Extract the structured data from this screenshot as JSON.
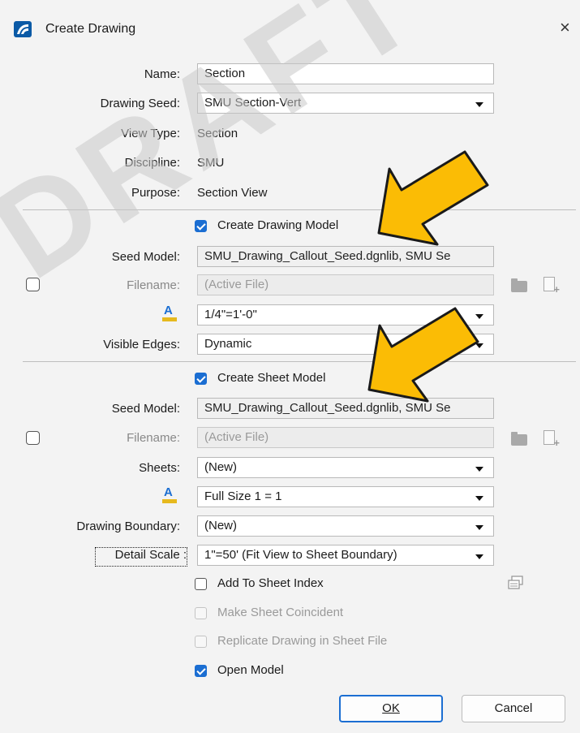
{
  "window": {
    "title": "Create Drawing",
    "close_glyph": "×"
  },
  "watermark": "DRAFT",
  "general": {
    "name_label": "Name:",
    "name_value": "Section",
    "drawing_seed_label": "Drawing Seed:",
    "drawing_seed_value": "SMU Section-Vert",
    "view_type_label": "View Type:",
    "view_type_value": "Section",
    "discipline_label": "Discipline:",
    "discipline_value": "SMU",
    "purpose_label": "Purpose:",
    "purpose_value": "Section View"
  },
  "drawing_model": {
    "create_label": "Create Drawing Model",
    "create_checked": true,
    "seed_model_label": "Seed Model:",
    "seed_model_value": "SMU_Drawing_Callout_Seed.dgnlib, SMU Se",
    "filename_label": "Filename:",
    "filename_value": "(Active File)",
    "annotation_scale_value": "1/4\"=1'-0\"",
    "visible_edges_label": "Visible Edges:",
    "visible_edges_value": "Dynamic"
  },
  "sheet_model": {
    "create_label": "Create Sheet Model",
    "create_checked": true,
    "seed_model_label": "Seed Model:",
    "seed_model_value": "SMU_Drawing_Callout_Seed.dgnlib, SMU Se",
    "filename_label": "Filename:",
    "filename_value": "(Active File)",
    "sheets_label": "Sheets:",
    "sheets_value": "(New)",
    "annotation_scale_value": "Full Size 1 = 1",
    "drawing_boundary_label": "Drawing Boundary:",
    "drawing_boundary_value": "(New)",
    "detail_scale_label": "Detail Scale :",
    "detail_scale_value": "1\"=50' (Fit View to Sheet Boundary)",
    "add_to_sheet_index_label": "Add To Sheet Index",
    "add_to_sheet_index_checked": false,
    "make_coincident_label": "Make Sheet Coincident",
    "replicate_label": "Replicate Drawing in Sheet File",
    "open_model_label": "Open Model",
    "open_model_checked": true
  },
  "buttons": {
    "ok": "OK",
    "cancel": "Cancel"
  },
  "icons": {
    "app": "app-logo-icon",
    "close": "close-icon",
    "scale": "annotation-scale-icon",
    "browse": "folder-icon",
    "new_file": "new-file-icon",
    "sheet_index": "sheet-index-icon",
    "callout": "arrow-callout-icon"
  },
  "colors": {
    "accent": "#1b6ed2",
    "arrow_fill": "#fbbc05",
    "arrow_stroke": "#1a1a1a",
    "watermark": "#c8c8c8"
  }
}
